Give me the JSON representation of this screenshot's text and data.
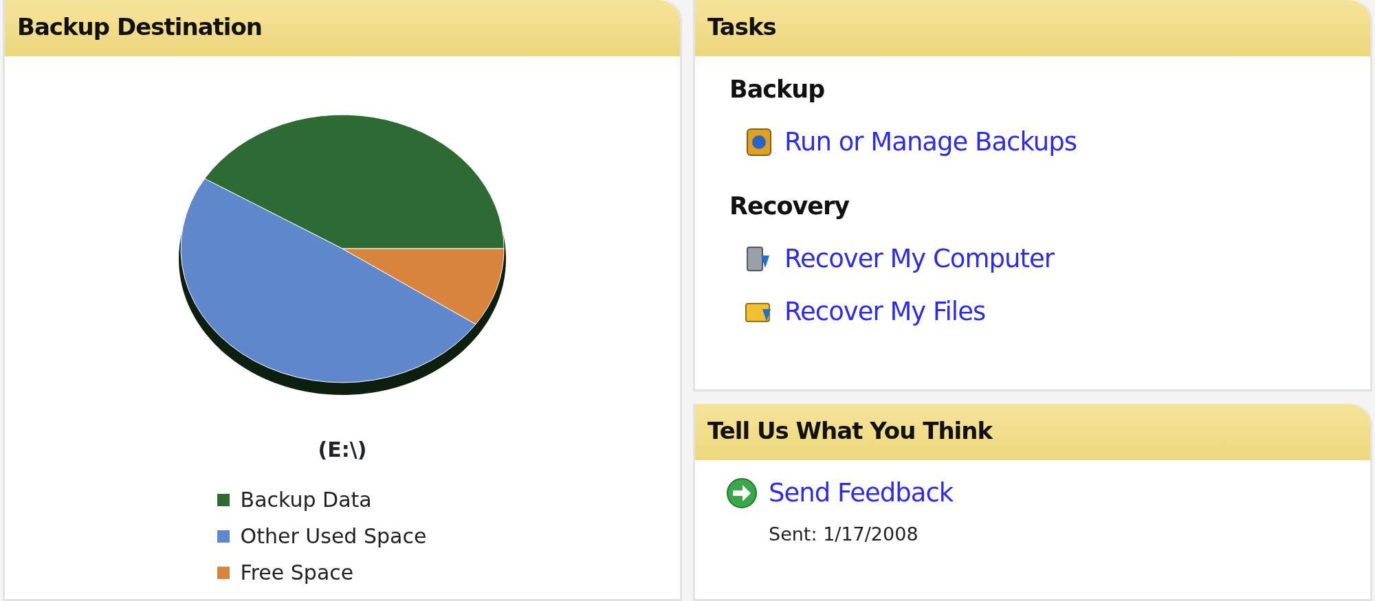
{
  "destination": {
    "title": "Backup Destination",
    "drive": "(E:\\)",
    "legend": [
      {
        "label": "Backup Data",
        "color": "#2e6b34"
      },
      {
        "label": "Other Used Space",
        "color": "#5f88cc"
      },
      {
        "label": "Free Space",
        "color": "#d9843c"
      }
    ]
  },
  "tasks": {
    "title": "Tasks",
    "sections": [
      {
        "heading": "Backup",
        "links": [
          {
            "label": "Run or Manage Backups",
            "kind": "backup"
          }
        ]
      },
      {
        "heading": "Recovery",
        "links": [
          {
            "label": "Recover My Computer",
            "kind": "computer"
          },
          {
            "label": "Recover My Files",
            "kind": "files"
          }
        ]
      }
    ]
  },
  "feedback": {
    "title": "Tell Us What You Think",
    "link": "Send Feedback",
    "sent": "Sent: 1/17/2008"
  }
}
